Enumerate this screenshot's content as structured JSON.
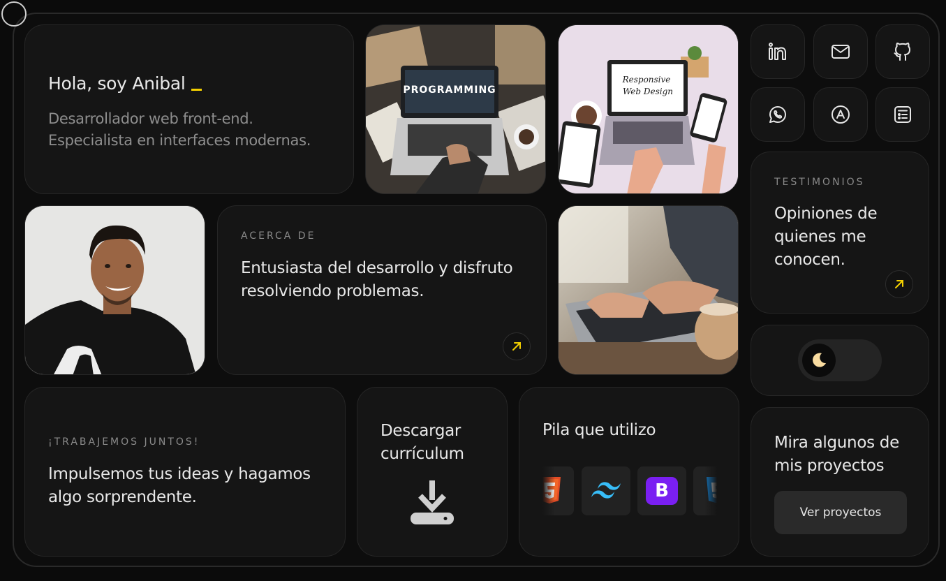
{
  "hero": {
    "greeting": "Hola, soy Anibal",
    "line1": "Desarrollador web front-end.",
    "line2": "Especialista en interfaces modernas."
  },
  "photos": {
    "programming_sign": "PROGRAMMING",
    "responsive_line1": "Responsive",
    "responsive_line2": "Web Design"
  },
  "about": {
    "eyebrow": "ACERCA DE",
    "line1": "Entusiasta del desarrollo y disfruto",
    "line2": "resolviendo problemas."
  },
  "testimonials": {
    "eyebrow": "TESTIMONIOS",
    "line1": "Opiniones de",
    "line2": "quienes me",
    "line3": "conocen."
  },
  "contact": {
    "eyebrow": "¡TRABAJEMOS JUNTOS!",
    "line1": "Impulsemos tus ideas y hagamos",
    "line2": "algo sorprendente."
  },
  "resume": {
    "line1": "Descargar",
    "line2": "currículum"
  },
  "stack": {
    "title": "Pila que utilizo",
    "items": [
      "html5-icon",
      "tailwind-icon",
      "bootstrap-icon",
      "css3-icon"
    ],
    "bootstrap_letter": "B"
  },
  "projects": {
    "line1": "Mira algunos de",
    "line2": "mis proyectos",
    "button": "Ver proyectos"
  },
  "socials": [
    "linkedin-icon",
    "mail-icon",
    "github-icon",
    "whatsapp-icon",
    "app-store-icon",
    "resume-list-icon"
  ],
  "theme_toggle": {
    "state": "dark"
  },
  "colors": {
    "accent": "#f4d000",
    "background": "#0d0d0d",
    "card": "#151515"
  }
}
